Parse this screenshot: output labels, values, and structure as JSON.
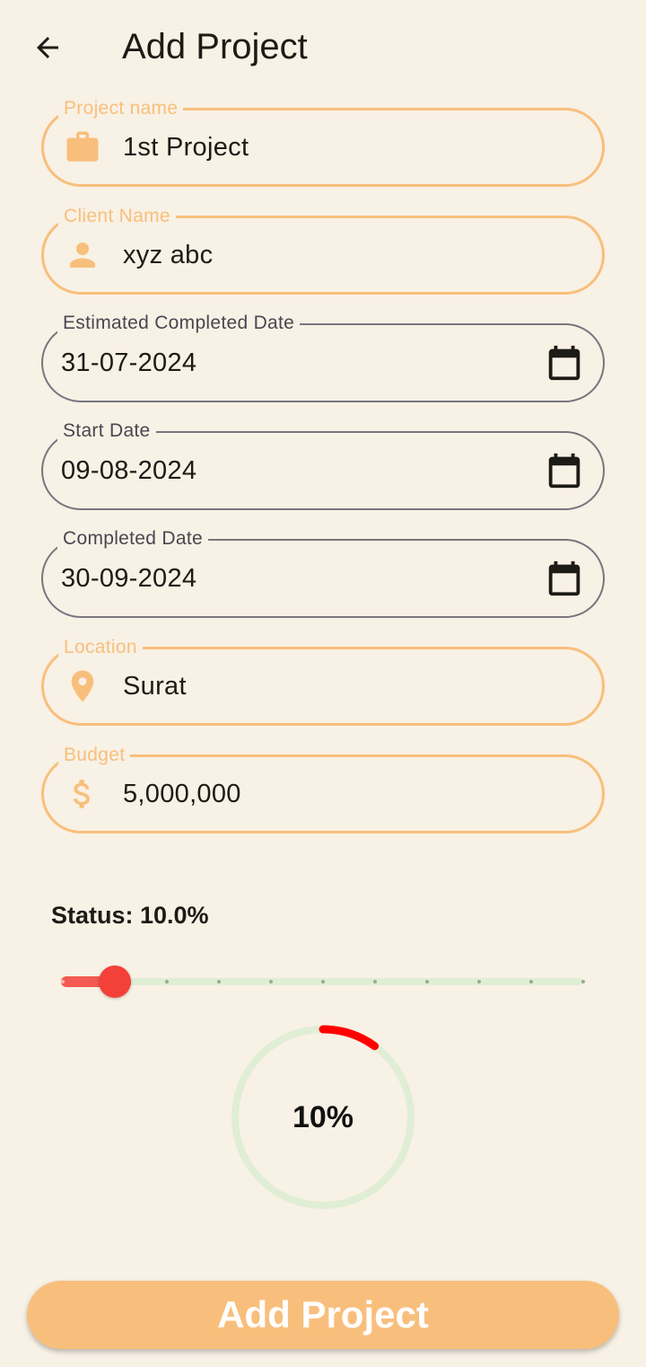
{
  "colors": {
    "background": "#f8f1e5",
    "accent": "#f8bf7c",
    "outline": "#79757f",
    "slider_active": "#f35a51",
    "slider_inactive": "#dfeed5",
    "progress_arc": "#ff0000",
    "progress_track": "#dfeed5"
  },
  "appbar": {
    "title": "Add Project",
    "back_icon": "arrow-back-icon"
  },
  "form": {
    "project_name": {
      "label": "Project name",
      "value": "1st Project",
      "icon": "briefcase-icon"
    },
    "client_name": {
      "label": "Client Name",
      "value": "xyz abc",
      "icon": "person-icon"
    },
    "estimated_completed_date": {
      "label": "Estimated Completed Date",
      "value": "31-07-2024",
      "icon": "calendar-icon"
    },
    "start_date": {
      "label": "Start Date",
      "value": "09-08-2024",
      "icon": "calendar-icon"
    },
    "completed_date": {
      "label": "Completed Date",
      "value": "30-09-2024",
      "icon": "calendar-icon"
    },
    "location": {
      "label": "Location",
      "value": "Surat",
      "icon": "location-pin-icon"
    },
    "budget": {
      "label": "Budget",
      "value": "5,000,000",
      "icon": "dollar-icon"
    }
  },
  "status": {
    "label": "Status: 10.0%",
    "slider": {
      "value": 0.1,
      "divisions": 10
    },
    "progress": {
      "value": 0.1,
      "text": "10%"
    }
  },
  "submit": {
    "label": "Add Project"
  }
}
